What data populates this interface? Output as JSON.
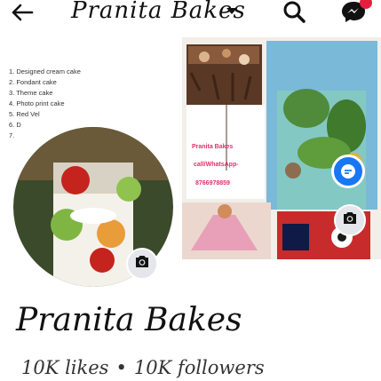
{
  "header": {
    "back_icon": "back-arrow-icon",
    "title": "Pranita Bakes",
    "search_icon": "search-icon",
    "messenger_icon": "messenger-icon"
  },
  "cover": {
    "menu_items": [
      "1.  Designed cream cake",
      "2.  Fondant cake",
      "3.  Theme cake",
      "4.  Photo print cake",
      "5.  Red Vel",
      "6.  D",
      "7."
    ],
    "banner_name": "Pranita Bakes",
    "banner_call": "call/WhatsApp-",
    "banner_phone": "8766978859"
  },
  "profile": {
    "name": "Pranita Bakes",
    "likes": "10K likes",
    "separator": "•",
    "followers": "10K followers"
  },
  "colors": {
    "accent": "#1877f2",
    "notification": "#e41e3f"
  }
}
